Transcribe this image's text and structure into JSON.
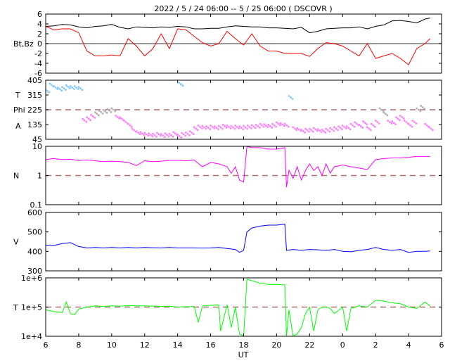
{
  "chart_data": {
    "type": "line",
    "title": "2022 /  5 / 24   06:00 --  5 / 25   06:00 ( DSCOVR )",
    "xlabel": "UT",
    "xlim": [
      6,
      30
    ],
    "xtick_labels": [
      "6",
      "8",
      "10",
      "12",
      "14",
      "16",
      "18",
      "20",
      "22",
      "0",
      "2",
      "4",
      "6"
    ],
    "panels": [
      {
        "id": "b",
        "ylabel": "Bt,Bz",
        "ylim": [
          -6,
          6
        ],
        "log": false,
        "ytick_labels": [
          "6",
          "4",
          "2",
          "0",
          "-2",
          "-4",
          "-6"
        ],
        "yticks": [
          6,
          4,
          2,
          0,
          -2,
          -4,
          -6
        ],
        "ref": 0,
        "ref_style": "solid",
        "series": [
          {
            "name": "Bt",
            "color": "#000000",
            "x": [
              6,
              6.5,
              7,
              7.5,
              8,
              8.5,
              9,
              9.5,
              10,
              10.5,
              11,
              11.5,
              12,
              12.5,
              13,
              13.5,
              14,
              14.5,
              15,
              15.5,
              16,
              16.5,
              17,
              17.5,
              18,
              18.5,
              19,
              19.5,
              20,
              20.5,
              21,
              21.5,
              22,
              22.5,
              23,
              23.5,
              24,
              24.5,
              25,
              25.5,
              26,
              26.5,
              27,
              27.5,
              28,
              28.5,
              29,
              29.3
            ],
            "y": [
              3.5,
              3.6,
              3.9,
              3.8,
              3.4,
              3.2,
              3.5,
              3.6,
              3.9,
              3.3,
              3.0,
              3.4,
              3.3,
              3.2,
              3.4,
              3.3,
              3.5,
              3.4,
              3.0,
              3.0,
              3.1,
              3.1,
              3.4,
              3.6,
              3.5,
              3.4,
              3.4,
              3.2,
              3.2,
              3.1,
              3.0,
              3.3,
              2.2,
              2.5,
              3.0,
              3.1,
              3.2,
              3.2,
              3.4,
              3.0,
              3.5,
              3.8,
              4.6,
              4.7,
              4.5,
              4.2,
              5.0,
              5.2
            ]
          },
          {
            "name": "Bz",
            "color": "#ff0000",
            "x": [
              6,
              6.5,
              7,
              7.5,
              8,
              8.5,
              9,
              9.5,
              10,
              10.5,
              11,
              11.5,
              12,
              12.5,
              13,
              13.5,
              14,
              14.5,
              15,
              15.5,
              16,
              16.5,
              17,
              17.5,
              18,
              18.5,
              19,
              19.5,
              20,
              20.5,
              21,
              21.5,
              22,
              22.5,
              23,
              23.5,
              24,
              24.5,
              25,
              25.5,
              26,
              26.5,
              27,
              27.5,
              28,
              28.5,
              29,
              29.3
            ],
            "y": [
              3.5,
              2.8,
              3.0,
              3.0,
              2.2,
              -1.5,
              -2.5,
              -2.5,
              -2.3,
              -2.5,
              1.0,
              -0.5,
              -2.5,
              -1.0,
              2.0,
              -1.0,
              3.0,
              2.8,
              1.5,
              0.2,
              -0.5,
              0.0,
              2.5,
              1.0,
              -0.3,
              2.0,
              -0.5,
              -1.5,
              -1.5,
              -2.0,
              -2.0,
              -2.0,
              -2.6,
              -1.0,
              0.2,
              0.0,
              -0.5,
              -1.5,
              -2.5,
              0.0,
              -3.0,
              -2.5,
              -2.0,
              -3.0,
              -4.3,
              -1.0,
              0.0,
              1.0
            ]
          }
        ]
      },
      {
        "id": "phi",
        "ylabel_parts": [
          "T",
          "Phi",
          "A"
        ],
        "ylim": [
          45,
          405
        ],
        "log": false,
        "ytick_labels": [
          "405",
          "315",
          "225",
          "135",
          "45"
        ],
        "yticks": [
          405,
          315,
          225,
          135,
          45
        ],
        "ref": 225,
        "ref_style": "dashed",
        "series": [
          {
            "name": "Phi",
            "style": "points",
            "colors": {
              "toward": "#80c8ff",
              "away": "#ff80ff",
              "neutral": "#b0b0b0"
            },
            "x": [
              6,
              6.25,
              6.5,
              6.75,
              7,
              7.25,
              7.5,
              7.75,
              8,
              8.25,
              8.5,
              8.75,
              9,
              9.25,
              9.5,
              9.75,
              10,
              10.25,
              10.5,
              10.75,
              11,
              11.25,
              11.5,
              11.75,
              12,
              12.25,
              12.5,
              12.75,
              13,
              13.25,
              13.5,
              13.75,
              14,
              14.1,
              14.25,
              14.5,
              14.75,
              15,
              15.25,
              15.5,
              15.75,
              16,
              16.25,
              16.5,
              16.75,
              17,
              17.25,
              17.5,
              17.75,
              18,
              18.25,
              18.5,
              18.75,
              19,
              19.25,
              19.5,
              19.75,
              20,
              20.25,
              20.5,
              20.75,
              21,
              21.25,
              21.5,
              21.75,
              22,
              22.25,
              22.5,
              22.75,
              23,
              23.25,
              23.5,
              23.75,
              24,
              24.25,
              24.5,
              24.75,
              25,
              25.25,
              25.5,
              25.75,
              26,
              26.25,
              26.5,
              26.75,
              27,
              27.25,
              27.5,
              27.75,
              28,
              28.25,
              28.5,
              28.75,
              29,
              29.25
            ],
            "y": [
              340,
              375,
              360,
              350,
              355,
              365,
              360,
              360,
              355,
              160,
              170,
              185,
              200,
              210,
              215,
              220,
              225,
              180,
              170,
              150,
              130,
              100,
              85,
              80,
              75,
              72,
              70,
              75,
              68,
              72,
              70,
              80,
              65,
              380,
              75,
              78,
              85,
              110,
              120,
              118,
              115,
              120,
              115,
              118,
              125,
              120,
              118,
              120,
              115,
              118,
              120,
              122,
              125,
              130,
              128,
              125,
              130,
              140,
              135,
              130,
              300,
              110,
              105,
              95,
              100,
              100,
              105,
              98,
              95,
              100,
              105,
              110,
              115,
              120,
              115,
              130,
              140,
              125,
              145,
              110,
              130,
              150,
              225,
              200,
              150,
              145,
              170,
              180,
              150,
              130,
              150,
              225,
              240,
              130,
              110,
              105
            ]
          }
        ]
      },
      {
        "id": "n",
        "ylabel": "N",
        "ylim": [
          0.1,
          10
        ],
        "log": true,
        "ytick_labels": [
          "10",
          "1",
          "0.1"
        ],
        "yticks": [
          10,
          1,
          0.1
        ],
        "ref": 1,
        "ref_style": "dashed",
        "series": [
          {
            "name": "N",
            "color": "#ff00ff",
            "x": [
              6,
              6.5,
              7,
              7.5,
              8,
              8.5,
              9,
              9.5,
              10,
              10.5,
              11,
              11.5,
              12,
              12.5,
              13,
              13.5,
              14,
              14.5,
              15,
              15.5,
              16,
              16.5,
              17,
              17.25,
              17.5,
              17.75,
              18,
              18.2,
              18.5,
              19,
              19.5,
              20,
              20.5,
              20.6,
              20.75,
              21,
              21.25,
              21.5,
              21.75,
              22,
              22.25,
              22.5,
              22.75,
              23,
              23.25,
              23.5,
              24,
              24.5,
              25,
              25.5,
              26,
              26.5,
              27,
              27.5,
              28,
              28.5,
              29,
              29.3
            ],
            "y": [
              3.5,
              3.8,
              3.5,
              3.6,
              3.3,
              3.4,
              3.2,
              3.0,
              3.1,
              3.0,
              2.8,
              2.2,
              3.2,
              3.0,
              3.1,
              3.3,
              3.3,
              3.2,
              3.4,
              2.0,
              2.8,
              2.5,
              2.0,
              1.2,
              2.0,
              0.7,
              0.6,
              10,
              9,
              9,
              8,
              8,
              9,
              0.4,
              1.5,
              0.8,
              2.0,
              0.7,
              1.5,
              2.5,
              1.5,
              2.0,
              1.0,
              2.5,
              1.2,
              2.0,
              2.3,
              2.0,
              1.8,
              1.6,
              3.5,
              3.8,
              4.0,
              4.0,
              4.2,
              4.5,
              4.5,
              4.5
            ]
          }
        ]
      },
      {
        "id": "v",
        "ylabel": "V",
        "ylim": [
          300,
          600
        ],
        "log": false,
        "ytick_labels": [
          "600",
          "500",
          "400",
          "300"
        ],
        "yticks": [
          600,
          500,
          400,
          300
        ],
        "series": [
          {
            "name": "V",
            "color": "#0000ff",
            "x": [
              6,
              6.5,
              7,
              7.5,
              8,
              8.5,
              9,
              9.5,
              10,
              10.5,
              11,
              11.5,
              12,
              12.5,
              13,
              13.5,
              14,
              14.5,
              15,
              15.5,
              16,
              16.5,
              17,
              17.5,
              17.75,
              18,
              18.2,
              18.5,
              19,
              19.5,
              20,
              20.5,
              20.6,
              21,
              21.5,
              22,
              22.5,
              23,
              23.5,
              24,
              24.5,
              25,
              25.5,
              26,
              26.5,
              27,
              27.5,
              28,
              28.5,
              29,
              29.3
            ],
            "y": [
              432,
              430,
              440,
              445,
              425,
              418,
              420,
              418,
              420,
              418,
              420,
              418,
              420,
              419,
              418,
              420,
              418,
              418,
              418,
              417,
              418,
              420,
              415,
              410,
              395,
              405,
              500,
              520,
              530,
              535,
              535,
              540,
              405,
              410,
              405,
              410,
              408,
              405,
              410,
              400,
              398,
              405,
              410,
              420,
              410,
              405,
              410,
              395,
              400,
              400,
              402
            ]
          }
        ]
      },
      {
        "id": "t",
        "ylabel": "T",
        "ylim": [
          10000,
          1000000
        ],
        "log": true,
        "ytick_labels": [
          "1e+6",
          "1e+5",
          "1e+4"
        ],
        "yticks": [
          1000000,
          100000,
          10000
        ],
        "ref": 100000,
        "ref_style": "dashed",
        "series": [
          {
            "name": "T",
            "color": "#00ff00",
            "x": [
              6,
              6.5,
              7,
              7.25,
              7.5,
              7.75,
              8,
              8.5,
              9,
              9.5,
              10,
              10.5,
              11,
              11.5,
              12,
              12.5,
              13,
              13.5,
              14,
              14.5,
              15,
              15.25,
              15.5,
              16,
              16.5,
              16.6,
              17,
              17.25,
              17.5,
              17.75,
              18,
              18.2,
              18.5,
              19,
              19.5,
              20,
              20.5,
              20.6,
              20.75,
              21,
              21.25,
              21.5,
              21.75,
              22,
              22.25,
              22.5,
              22.75,
              23,
              23.25,
              23.5,
              24,
              24.25,
              24.5,
              25,
              25.5,
              26,
              26.5,
              27,
              27.5,
              28,
              28.5,
              29,
              29.3
            ],
            "y": [
              80000,
              70000,
              65000,
              150000,
              60000,
              55000,
              85000,
              100000,
              110000,
              105000,
              110000,
              108000,
              112000,
              110000,
              110000,
              108000,
              105000,
              108000,
              100000,
              102000,
              105000,
              30000,
              110000,
              115000,
              118000,
              15000,
              120000,
              20000,
              100000,
              12000,
              10000,
              900000,
              800000,
              650000,
              600000,
              600000,
              580000,
              10000,
              80000,
              10000,
              12000,
              20000,
              60000,
              100000,
              15000,
              80000,
              100000,
              100000,
              90000,
              60000,
              100000,
              15000,
              90000,
              110000,
              100000,
              170000,
              160000,
              140000,
              130000,
              100000,
              90000,
              150000,
              110000
            ]
          }
        ]
      }
    ]
  }
}
